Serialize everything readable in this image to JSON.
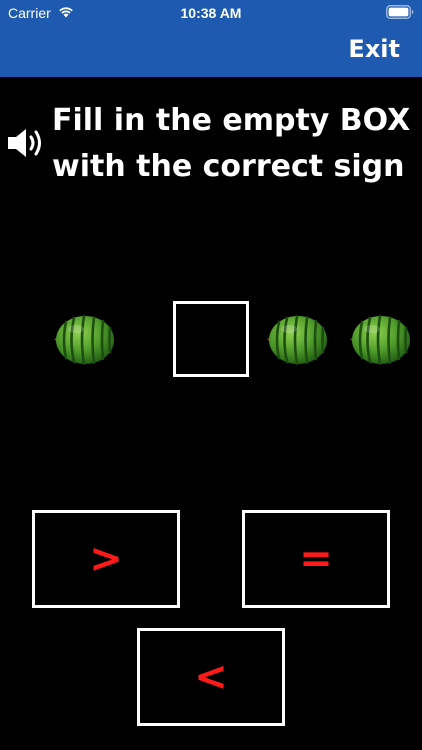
{
  "status_bar": {
    "carrier": "Carrier",
    "time": "10:38 AM"
  },
  "header": {
    "exit_label": "Exit",
    "background_color": "#1e5bb0"
  },
  "instruction": {
    "line1": "Fill in the empty BOX",
    "line2": "with the correct sign"
  },
  "comparison": {
    "left_items": [
      "watermark-emoji-watermelon"
    ],
    "left_count": 1,
    "right_count": 2,
    "item_icon": "watermelon-icon"
  },
  "answer_buttons": {
    "greater": ">",
    "equal": "=",
    "less": "<",
    "sign_color": "#ff1a1a"
  }
}
